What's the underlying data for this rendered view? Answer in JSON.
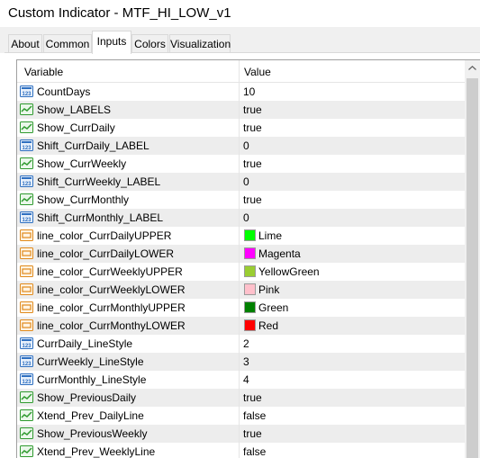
{
  "window": {
    "title": "Custom Indicator - MTF_HI_LOW_v1"
  },
  "tabs": [
    {
      "label": "About",
      "active": false
    },
    {
      "label": "Common",
      "active": false
    },
    {
      "label": "Inputs",
      "active": true
    },
    {
      "label": "Colors",
      "active": false
    },
    {
      "label": "Visualization",
      "active": false
    }
  ],
  "grid": {
    "headers": {
      "variable": "Variable",
      "value": "Value"
    },
    "rows": [
      {
        "type": "int",
        "name": "CountDays",
        "value": "10"
      },
      {
        "type": "bool",
        "name": "Show_LABELS",
        "value": "true"
      },
      {
        "type": "bool",
        "name": "Show_CurrDaily",
        "value": "true"
      },
      {
        "type": "int",
        "name": "Shift_CurrDaily_LABEL",
        "value": "0"
      },
      {
        "type": "bool",
        "name": "Show_CurrWeekly",
        "value": "true"
      },
      {
        "type": "int",
        "name": "Shift_CurrWeekly_LABEL",
        "value": "0"
      },
      {
        "type": "bool",
        "name": "Show_CurrMonthly",
        "value": "true"
      },
      {
        "type": "int",
        "name": "Shift_CurrMonthly_LABEL",
        "value": "0"
      },
      {
        "type": "color",
        "name": "line_color_CurrDailyUPPER",
        "value": "Lime",
        "color": "#00ff00"
      },
      {
        "type": "color",
        "name": "line_color_CurrDailyLOWER",
        "value": "Magenta",
        "color": "#ff00ff"
      },
      {
        "type": "color",
        "name": "line_color_CurrWeeklyUPPER",
        "value": "YellowGreen",
        "color": "#9acd32"
      },
      {
        "type": "color",
        "name": "line_color_CurrWeeklyLOWER",
        "value": "Pink",
        "color": "#ffc0cb"
      },
      {
        "type": "color",
        "name": "line_color_CurrMonthlyUPPER",
        "value": "Green",
        "color": "#008000"
      },
      {
        "type": "color",
        "name": "line_color_CurrMonthyLOWER",
        "value": "Red",
        "color": "#ff0000"
      },
      {
        "type": "int",
        "name": "CurrDaily_LineStyle",
        "value": "2"
      },
      {
        "type": "int",
        "name": "CurrWeekly_LineStyle",
        "value": "3"
      },
      {
        "type": "int",
        "name": "CurrMonthly_LineStyle",
        "value": "4"
      },
      {
        "type": "bool",
        "name": "Show_PreviousDaily",
        "value": "true"
      },
      {
        "type": "bool",
        "name": "Xtend_Prev_DailyLine",
        "value": "false"
      },
      {
        "type": "bool",
        "name": "Show_PreviousWeekly",
        "value": "true"
      },
      {
        "type": "bool",
        "name": "Xtend_Prev_WeeklyLine",
        "value": "false"
      }
    ]
  },
  "icons": {
    "int": "integer-param-icon",
    "bool": "boolean-param-icon",
    "color": "color-param-icon"
  },
  "colors": {
    "alt_row": "#ededed",
    "int_icon": "#2e6fc0",
    "bool_icon": "#2f9a2f",
    "color_icon": "#e08a1c"
  }
}
